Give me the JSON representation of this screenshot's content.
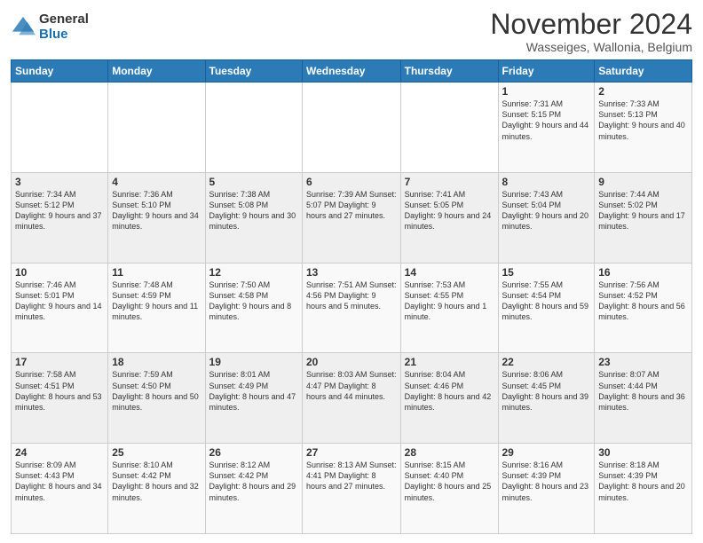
{
  "logo": {
    "general": "General",
    "blue": "Blue"
  },
  "header": {
    "month": "November 2024",
    "location": "Wasseiges, Wallonia, Belgium"
  },
  "weekdays": [
    "Sunday",
    "Monday",
    "Tuesday",
    "Wednesday",
    "Thursday",
    "Friday",
    "Saturday"
  ],
  "weeks": [
    [
      {
        "day": "",
        "info": ""
      },
      {
        "day": "",
        "info": ""
      },
      {
        "day": "",
        "info": ""
      },
      {
        "day": "",
        "info": ""
      },
      {
        "day": "",
        "info": ""
      },
      {
        "day": "1",
        "info": "Sunrise: 7:31 AM\nSunset: 5:15 PM\nDaylight: 9 hours\nand 44 minutes."
      },
      {
        "day": "2",
        "info": "Sunrise: 7:33 AM\nSunset: 5:13 PM\nDaylight: 9 hours\nand 40 minutes."
      }
    ],
    [
      {
        "day": "3",
        "info": "Sunrise: 7:34 AM\nSunset: 5:12 PM\nDaylight: 9 hours\nand 37 minutes."
      },
      {
        "day": "4",
        "info": "Sunrise: 7:36 AM\nSunset: 5:10 PM\nDaylight: 9 hours\nand 34 minutes."
      },
      {
        "day": "5",
        "info": "Sunrise: 7:38 AM\nSunset: 5:08 PM\nDaylight: 9 hours\nand 30 minutes."
      },
      {
        "day": "6",
        "info": "Sunrise: 7:39 AM\nSunset: 5:07 PM\nDaylight: 9 hours\nand 27 minutes."
      },
      {
        "day": "7",
        "info": "Sunrise: 7:41 AM\nSunset: 5:05 PM\nDaylight: 9 hours\nand 24 minutes."
      },
      {
        "day": "8",
        "info": "Sunrise: 7:43 AM\nSunset: 5:04 PM\nDaylight: 9 hours\nand 20 minutes."
      },
      {
        "day": "9",
        "info": "Sunrise: 7:44 AM\nSunset: 5:02 PM\nDaylight: 9 hours\nand 17 minutes."
      }
    ],
    [
      {
        "day": "10",
        "info": "Sunrise: 7:46 AM\nSunset: 5:01 PM\nDaylight: 9 hours\nand 14 minutes."
      },
      {
        "day": "11",
        "info": "Sunrise: 7:48 AM\nSunset: 4:59 PM\nDaylight: 9 hours\nand 11 minutes."
      },
      {
        "day": "12",
        "info": "Sunrise: 7:50 AM\nSunset: 4:58 PM\nDaylight: 9 hours\nand 8 minutes."
      },
      {
        "day": "13",
        "info": "Sunrise: 7:51 AM\nSunset: 4:56 PM\nDaylight: 9 hours\nand 5 minutes."
      },
      {
        "day": "14",
        "info": "Sunrise: 7:53 AM\nSunset: 4:55 PM\nDaylight: 9 hours\nand 1 minute."
      },
      {
        "day": "15",
        "info": "Sunrise: 7:55 AM\nSunset: 4:54 PM\nDaylight: 8 hours\nand 59 minutes."
      },
      {
        "day": "16",
        "info": "Sunrise: 7:56 AM\nSunset: 4:52 PM\nDaylight: 8 hours\nand 56 minutes."
      }
    ],
    [
      {
        "day": "17",
        "info": "Sunrise: 7:58 AM\nSunset: 4:51 PM\nDaylight: 8 hours\nand 53 minutes."
      },
      {
        "day": "18",
        "info": "Sunrise: 7:59 AM\nSunset: 4:50 PM\nDaylight: 8 hours\nand 50 minutes."
      },
      {
        "day": "19",
        "info": "Sunrise: 8:01 AM\nSunset: 4:49 PM\nDaylight: 8 hours\nand 47 minutes."
      },
      {
        "day": "20",
        "info": "Sunrise: 8:03 AM\nSunset: 4:47 PM\nDaylight: 8 hours\nand 44 minutes."
      },
      {
        "day": "21",
        "info": "Sunrise: 8:04 AM\nSunset: 4:46 PM\nDaylight: 8 hours\nand 42 minutes."
      },
      {
        "day": "22",
        "info": "Sunrise: 8:06 AM\nSunset: 4:45 PM\nDaylight: 8 hours\nand 39 minutes."
      },
      {
        "day": "23",
        "info": "Sunrise: 8:07 AM\nSunset: 4:44 PM\nDaylight: 8 hours\nand 36 minutes."
      }
    ],
    [
      {
        "day": "24",
        "info": "Sunrise: 8:09 AM\nSunset: 4:43 PM\nDaylight: 8 hours\nand 34 minutes."
      },
      {
        "day": "25",
        "info": "Sunrise: 8:10 AM\nSunset: 4:42 PM\nDaylight: 8 hours\nand 32 minutes."
      },
      {
        "day": "26",
        "info": "Sunrise: 8:12 AM\nSunset: 4:42 PM\nDaylight: 8 hours\nand 29 minutes."
      },
      {
        "day": "27",
        "info": "Sunrise: 8:13 AM\nSunset: 4:41 PM\nDaylight: 8 hours\nand 27 minutes."
      },
      {
        "day": "28",
        "info": "Sunrise: 8:15 AM\nSunset: 4:40 PM\nDaylight: 8 hours\nand 25 minutes."
      },
      {
        "day": "29",
        "info": "Sunrise: 8:16 AM\nSunset: 4:39 PM\nDaylight: 8 hours\nand 23 minutes."
      },
      {
        "day": "30",
        "info": "Sunrise: 8:18 AM\nSunset: 4:39 PM\nDaylight: 8 hours\nand 20 minutes."
      }
    ]
  ]
}
